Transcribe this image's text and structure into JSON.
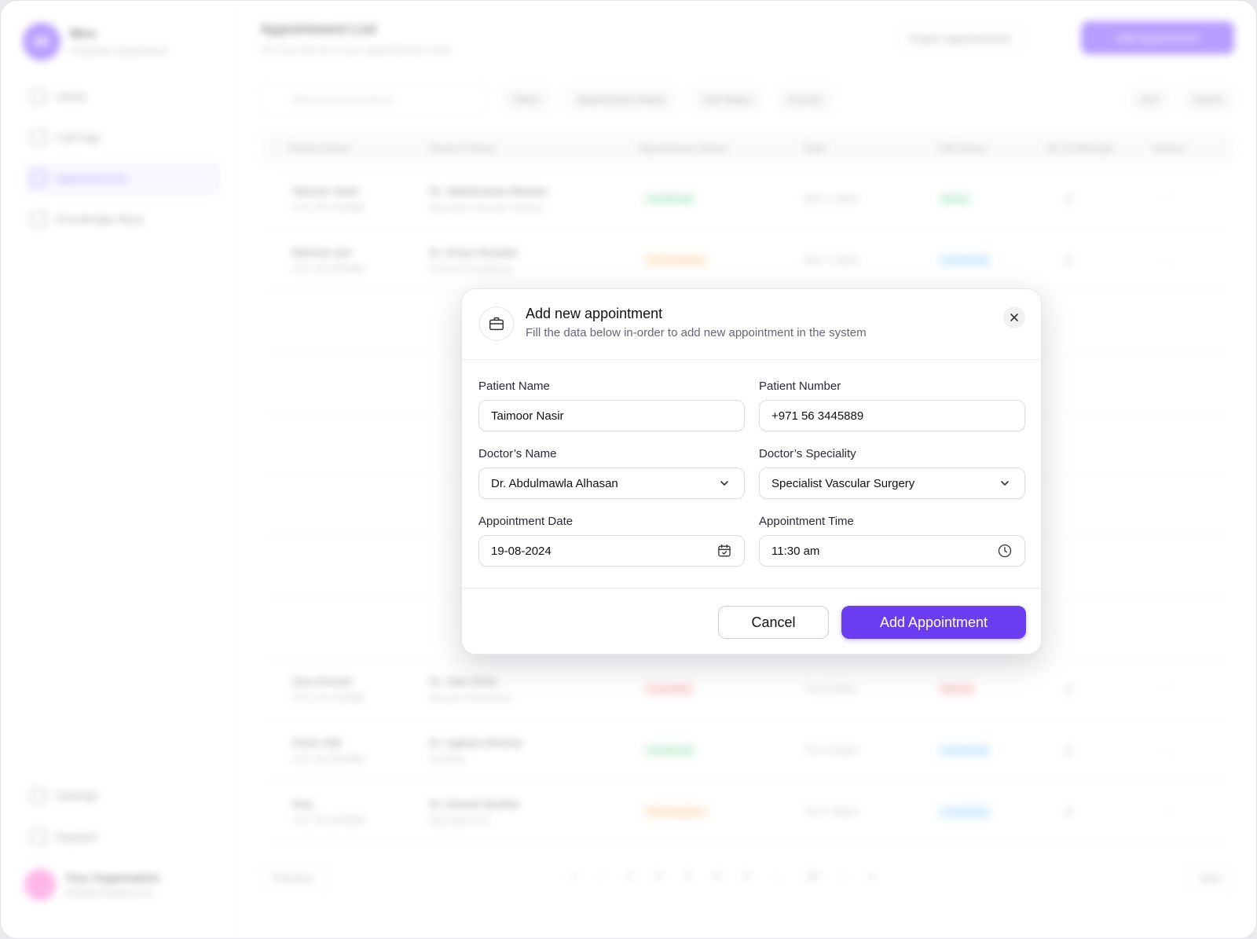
{
  "sidebar": {
    "brand_initials": "Mi",
    "brand_name": "Miro",
    "brand_sub": "Customer Experience",
    "items": [
      {
        "label": "Home"
      },
      {
        "label": "Call logs"
      },
      {
        "label": "Appointments"
      },
      {
        "label": "Knowledge Base"
      }
    ],
    "bottom_items": [
      {
        "label": "Settings"
      },
      {
        "label": "Support"
      }
    ],
    "org_name": "Your Organization",
    "org_email": "hello@company.com"
  },
  "header": {
    "title": "Appointment List",
    "subtitle": "You can find all of your appointments here",
    "export_label": "Export Appointments",
    "add_label": "Add Appointment"
  },
  "toolbar": {
    "search_placeholder": "Search by any column",
    "filters_label": "Filters",
    "status_label": "Appointment Status",
    "call_status_label": "Call Status",
    "doctors_label": "Doctors",
    "sort_label": "Sort",
    "export_label": "Export"
  },
  "table": {
    "headers": [
      "Patient Name",
      "Doctor's Name",
      "Appointment Status",
      "Date",
      "Call Status",
      "No of Attempts",
      "Actions"
    ],
    "rows": [
      {
        "name": "Taimoor Nasir",
        "phone": "+971 56 3445889",
        "doctor": "Dr. Abdulmawla Alhasan",
        "spec": "Specialist Vascular Surgery",
        "status": "Confirmed",
        "status_class": "st-green",
        "date": "Mon 1:30pm",
        "call": "Active",
        "call_class": "st-green",
        "attempts": "2"
      },
      {
        "name": "Mahesh Iyer",
        "phone": "+971 56 3445889",
        "doctor": "Dr. Eman Mustafa",
        "spec": "General Practitioner",
        "status": "Rescheduled",
        "status_class": "st-orange",
        "date": "Mon 1:30pm",
        "call": "Completed",
        "call_class": "st-blue",
        "attempts": "2"
      }
    ],
    "extra_rows": [
      {
        "name": "Zara Ahmed",
        "phone": "+971 56 3445889",
        "doctor": "Dr. Aida Hinta",
        "spec": "General Practitioner",
        "status": "Cancelled",
        "status_class": "st-red",
        "date": "Tue 6:30pm",
        "call": "Missed",
        "call_class": "st-red",
        "attempts": "2"
      },
      {
        "name": "Omar Hall",
        "phone": "+971 56 3445889",
        "doctor": "Dr. Aghiad Alshmar",
        "spec": "Dentistry",
        "status": "Confirmed",
        "status_class": "st-green",
        "date": "Thu 6:30pm",
        "call": "Completed",
        "call_class": "st-blue",
        "attempts": "2"
      },
      {
        "name": "Amy",
        "phone": "+971 56 3445889",
        "doctor": "Dr. Ahmed Ibrahim",
        "spec": "Specialist ENT",
        "status": "Rescheduled",
        "status_class": "st-orange",
        "date": "Thu 1:30pm",
        "call": "Completed",
        "call_class": "st-blue",
        "attempts": "2"
      }
    ]
  },
  "pagination": {
    "prev_label": "Previous",
    "next_label": "Next",
    "pages": [
      "«",
      "‹",
      "1",
      "2",
      "3",
      "4",
      "5",
      "…",
      "10",
      "›",
      "»"
    ]
  },
  "modal": {
    "title": "Add new appointment",
    "subtitle": "Fill the data below in-order to add new appointment in the system",
    "fields": {
      "patient_name": {
        "label": "Patient Name",
        "value": "Taimoor Nasir"
      },
      "patient_number": {
        "label": "Patient Number",
        "value": "+971 56 3445889"
      },
      "doctor_name": {
        "label": "Doctor’s Name",
        "value": "Dr. Abdulmawla Alhasan"
      },
      "doctor_speciality": {
        "label": "Doctor’s Speciality",
        "value": "Specialist Vascular Surgery"
      },
      "appointment_date": {
        "label": "Appointment Date",
        "value": "19-08-2024"
      },
      "appointment_time": {
        "label": "Appointment Time",
        "value": "11:30 am"
      }
    },
    "cancel_label": "Cancel",
    "submit_label": "Add Appointment"
  },
  "colors": {
    "accent": "#6a3df0",
    "border": "#dcdce3"
  }
}
